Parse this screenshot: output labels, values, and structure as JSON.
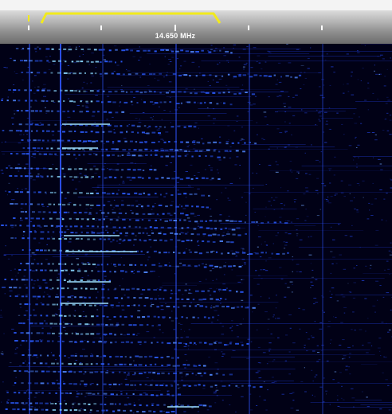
{
  "scale": {
    "center_frequency_label": "14.650 MHz"
  },
  "colors": {
    "passband": "#f2ea1c",
    "waterfall_background": "#010116",
    "signal": "#2b5cff",
    "signal_peak": "#8ad8ff"
  },
  "icons": {
    "passband_filter": "yellow-trapezoid-filter-marker"
  }
}
